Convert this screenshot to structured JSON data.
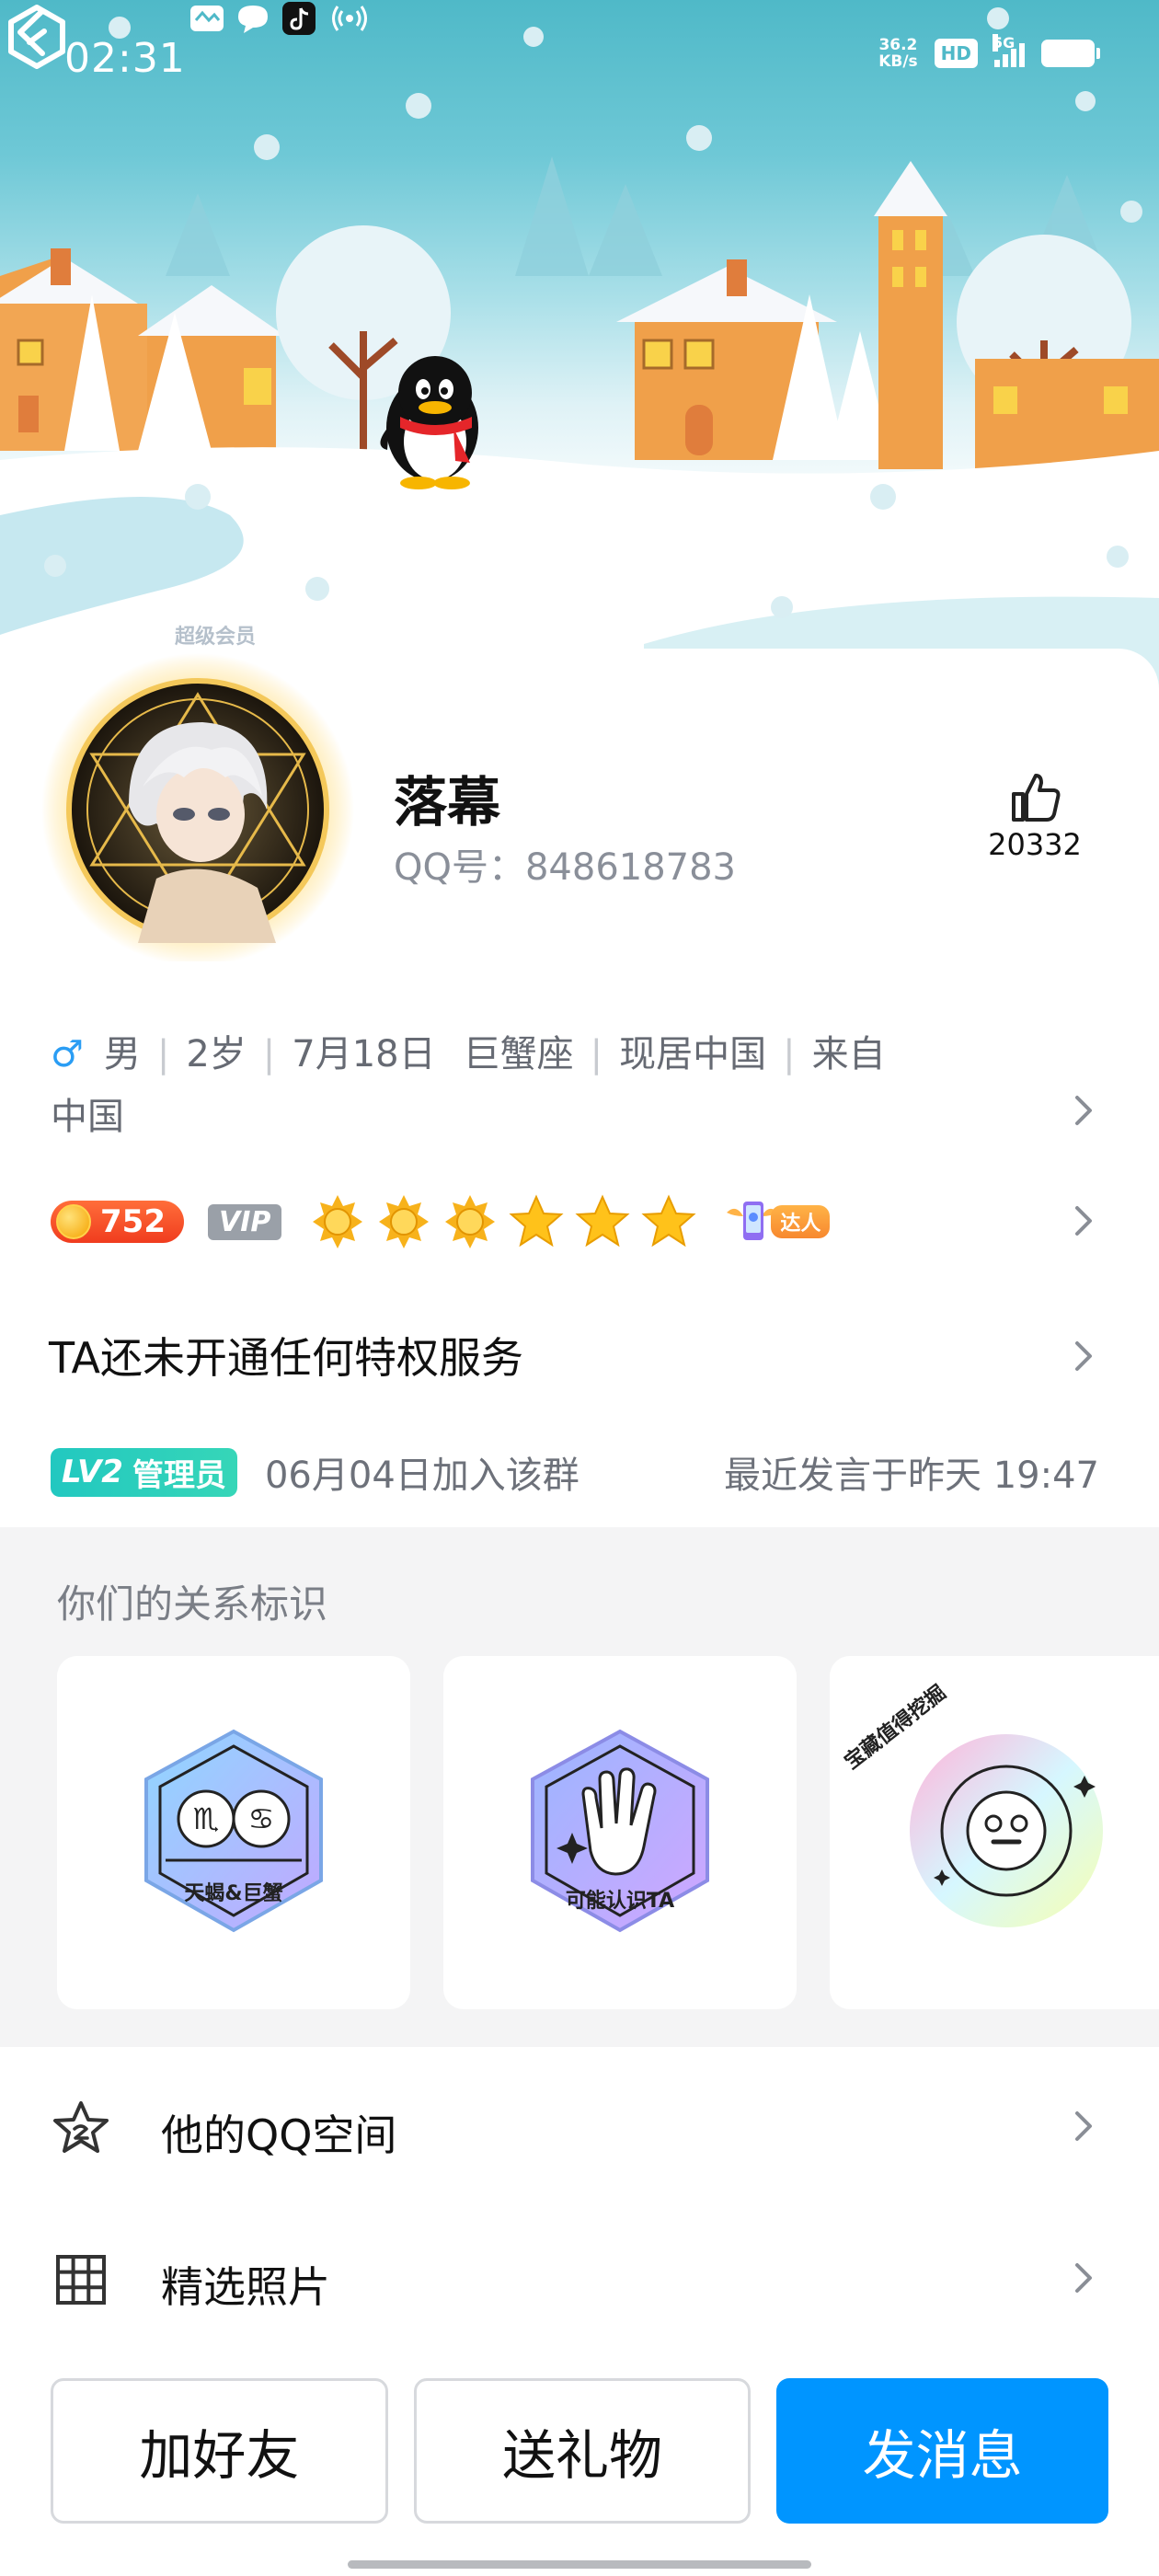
{
  "status_bar": {
    "time": "02:31",
    "net_speed_value": "36.2",
    "net_speed_unit": "KB/s",
    "hd_label": "HD",
    "network_label": "5G"
  },
  "profile": {
    "vip_tag": "超级会员",
    "nickname": "落幕",
    "qq_number": "QQ号：848618783",
    "like_count": "20332"
  },
  "info": {
    "gender_symbol": "♂",
    "gender": "男",
    "age": "2岁",
    "birthday": "7月18日",
    "zodiac": "巨蟹座",
    "residence": "现居中国",
    "from_label": "来自",
    "hometown": "中国"
  },
  "badges": {
    "coin_value": "752",
    "vip_label": "VIP",
    "talent_label": "达人"
  },
  "privilege_text": "TA还未开通任何特权服务",
  "group": {
    "lv_label": "LV2",
    "role": "管理员",
    "join_text": "06月04日加入该群",
    "last_speak": "最近发言于昨天  19:47"
  },
  "relationship": {
    "title": "你们的关系标识",
    "cards": [
      {
        "label": "天蝎&巨蟹"
      },
      {
        "label": "可能认识TA"
      },
      {
        "label": "宝藏值得挖掘"
      }
    ]
  },
  "list": {
    "qzone_label": "他的QQ空间",
    "photos_label": "精选照片"
  },
  "actions": {
    "add_friend": "加好友",
    "send_gift": "送礼物",
    "send_message": "发消息"
  },
  "colors": {
    "primary": "#0095ff",
    "lv_badge": "#22c8c0",
    "coin_badge": "#f03c1e"
  }
}
